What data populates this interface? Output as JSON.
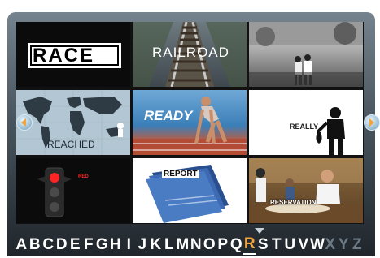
{
  "tiles": [
    {
      "label": "RACE"
    },
    {
      "label": "RAILROAD"
    },
    {
      "label": ""
    },
    {
      "label": "REACHED"
    },
    {
      "label": "READY"
    },
    {
      "label": "REALLY"
    },
    {
      "label": "RED"
    },
    {
      "label": "REPORT"
    },
    {
      "label": "RESERVATION"
    }
  ],
  "alphabet": [
    "A",
    "B",
    "C",
    "D",
    "E",
    "F",
    "G",
    "H",
    "I",
    "J",
    "K",
    "L",
    "M",
    "N",
    "O",
    "P",
    "Q",
    "R",
    "S",
    "T",
    "U",
    "V",
    "W",
    "X",
    "Y",
    "Z"
  ],
  "selected_letter": "R",
  "dimmed_letters": [
    "X",
    "Y",
    "Z"
  ],
  "colors": {
    "accent": "#f2a33a",
    "frame": "#48545d"
  }
}
